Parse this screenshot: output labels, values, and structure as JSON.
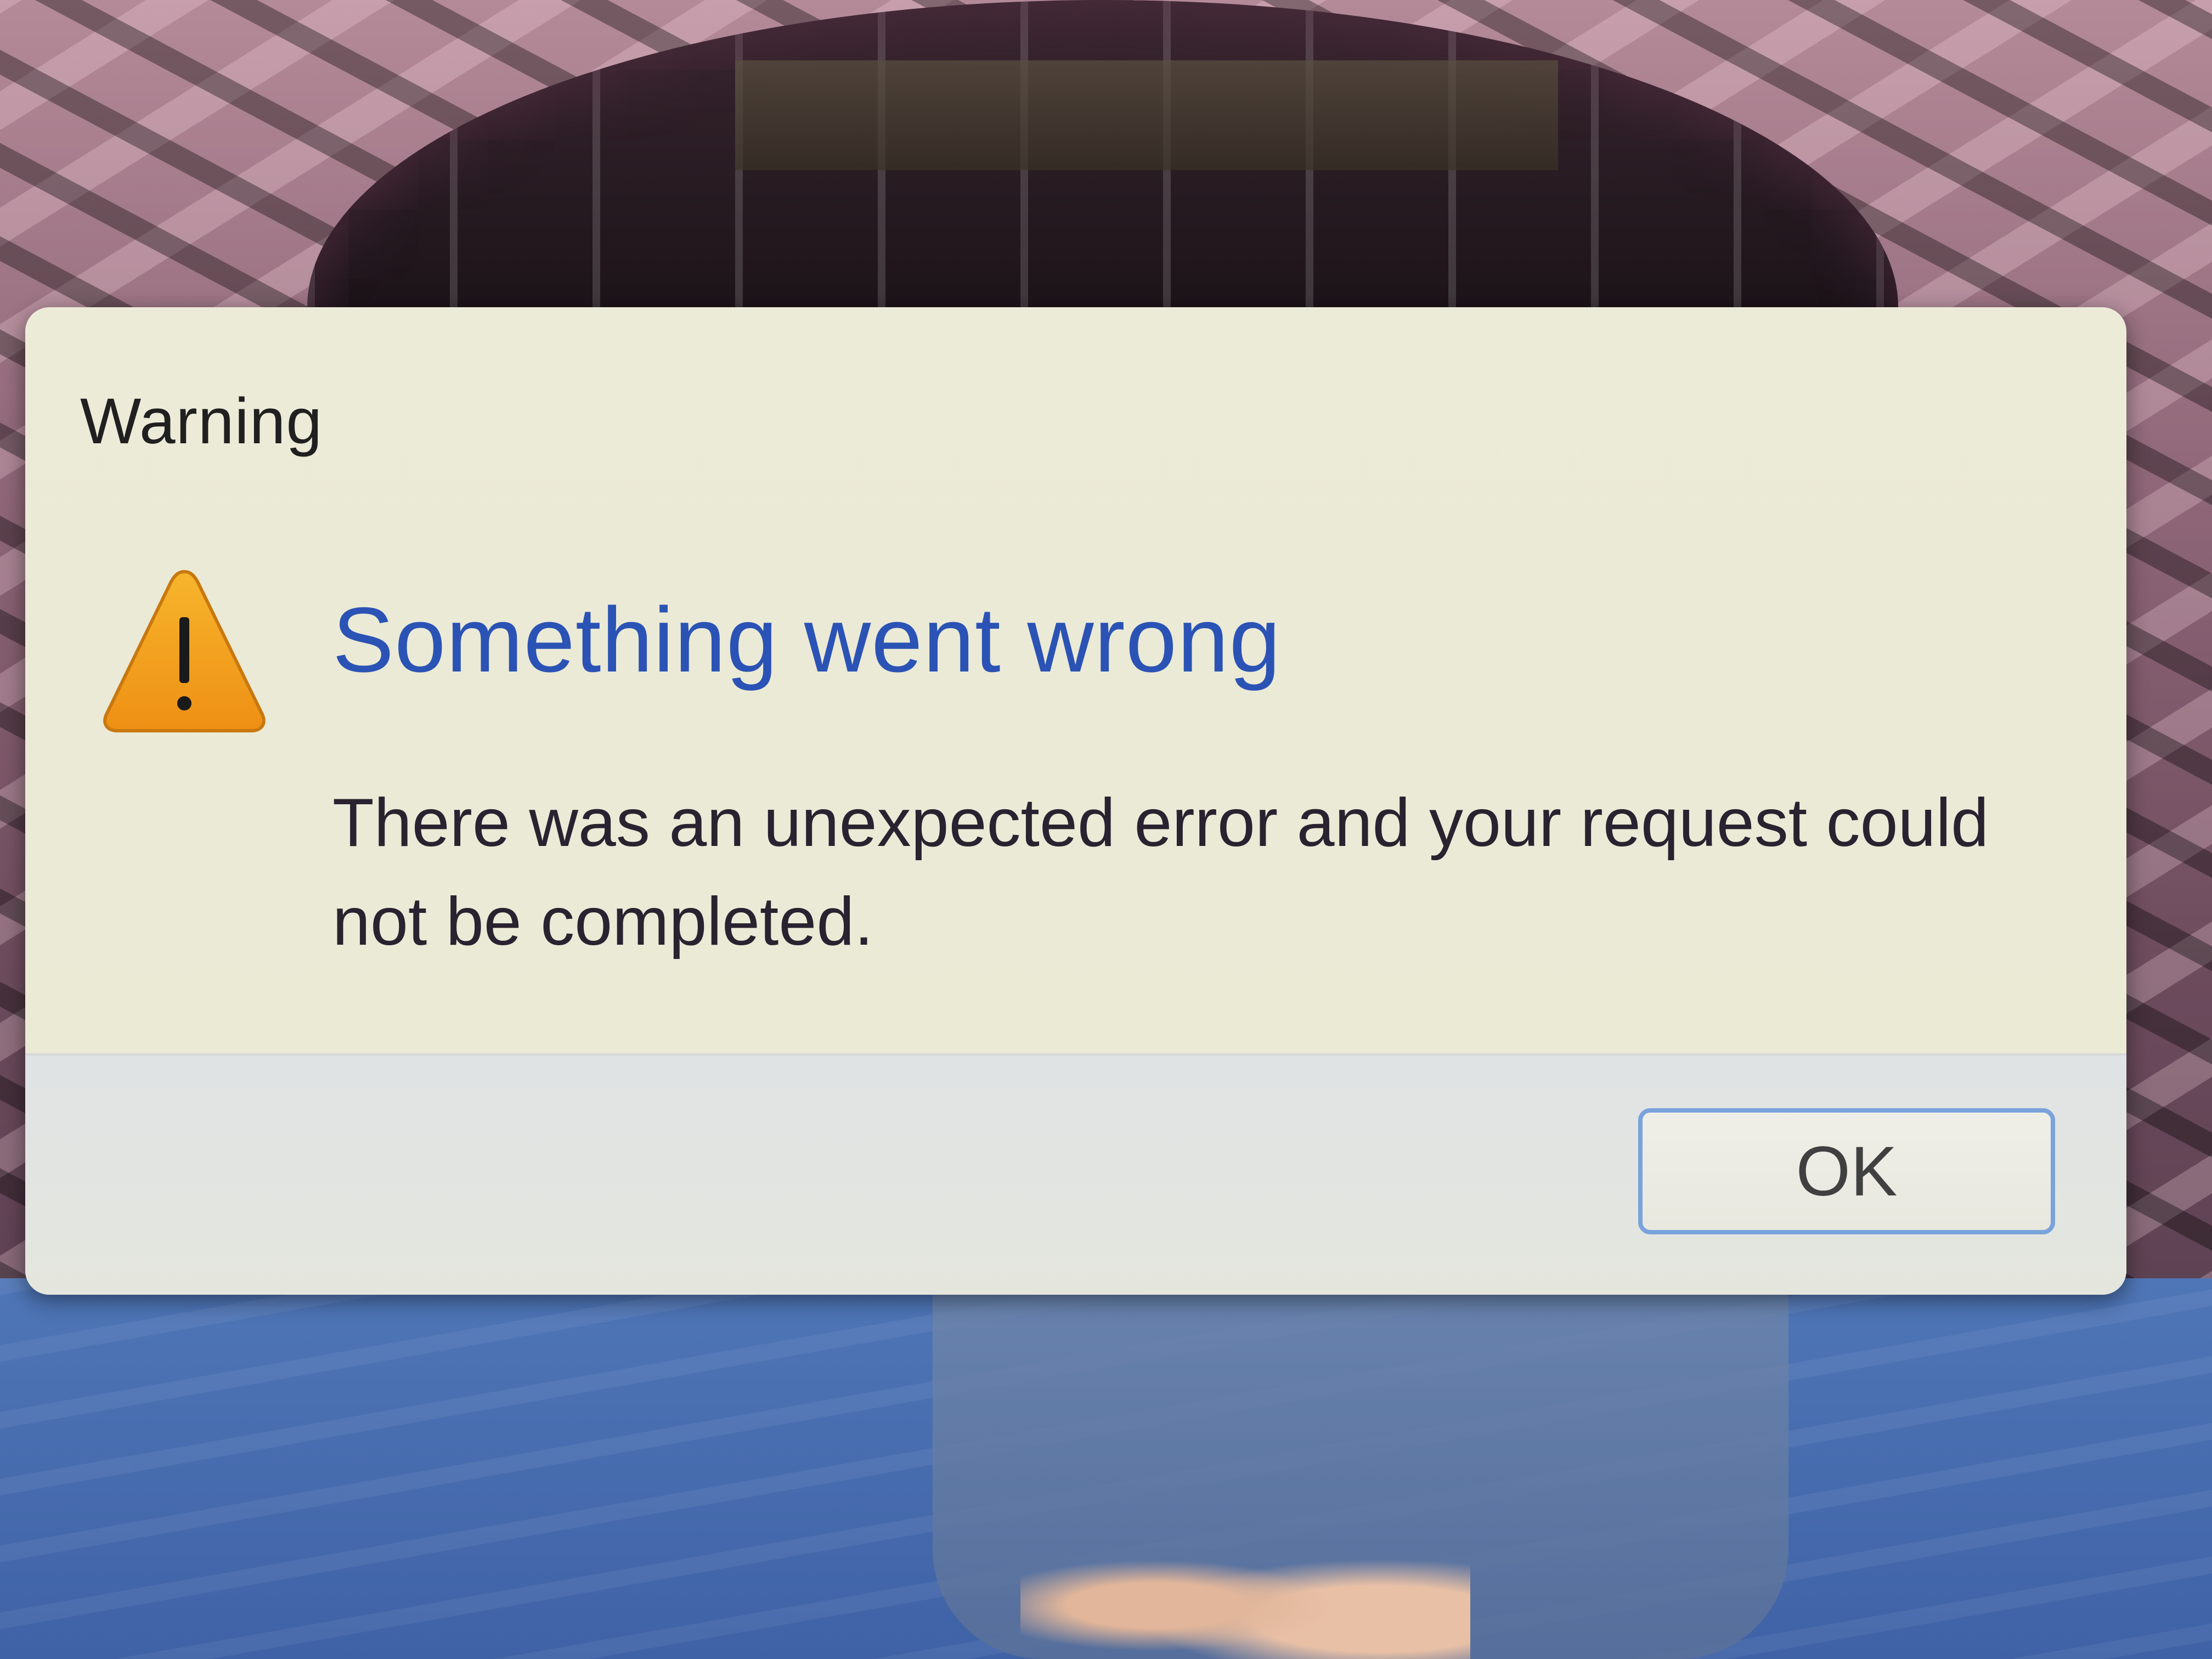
{
  "dialog": {
    "title": "Warning",
    "icon": "warning-icon",
    "headline": "Something went wrong",
    "message": "There was an unexpected error and your request could not be completed.",
    "ok_label": "OK"
  },
  "colors": {
    "headline": "#2b53b5",
    "icon_fill": "#f2a21d",
    "button_border": "#7aa3dc"
  }
}
